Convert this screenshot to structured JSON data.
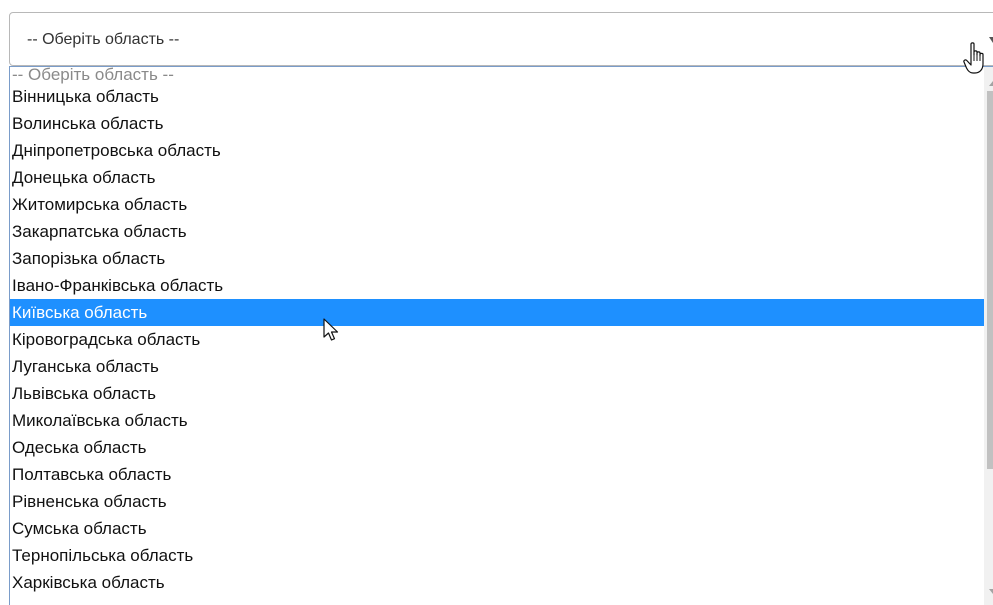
{
  "select": {
    "value": "-- Оберіть область --"
  },
  "dropdown": {
    "options": [
      "-- Оберіть область --",
      "Вінницька область",
      "Волинська область",
      "Дніпропетровська область",
      "Донецька область",
      "Житомирська область",
      "Закарпатська область",
      "Запорізька область",
      "Івано-Франківська область",
      "Київська область",
      "Кіровоградська область",
      "Луганська область",
      "Львівська область",
      "Миколаївська область",
      "Одеська область",
      "Полтавська область",
      "Рівненська область",
      "Сумська область",
      "Тернопільська область",
      "Харківська область"
    ],
    "highlighted_option": "Київська область"
  },
  "cursors": {
    "over_select": "hand-pointer-icon",
    "over_list": "arrow-pointer-icon"
  },
  "colors": {
    "highlight": "#1e90ff",
    "highlight_text": "#ffffff",
    "dropdown_border": "#7a9cc9"
  }
}
